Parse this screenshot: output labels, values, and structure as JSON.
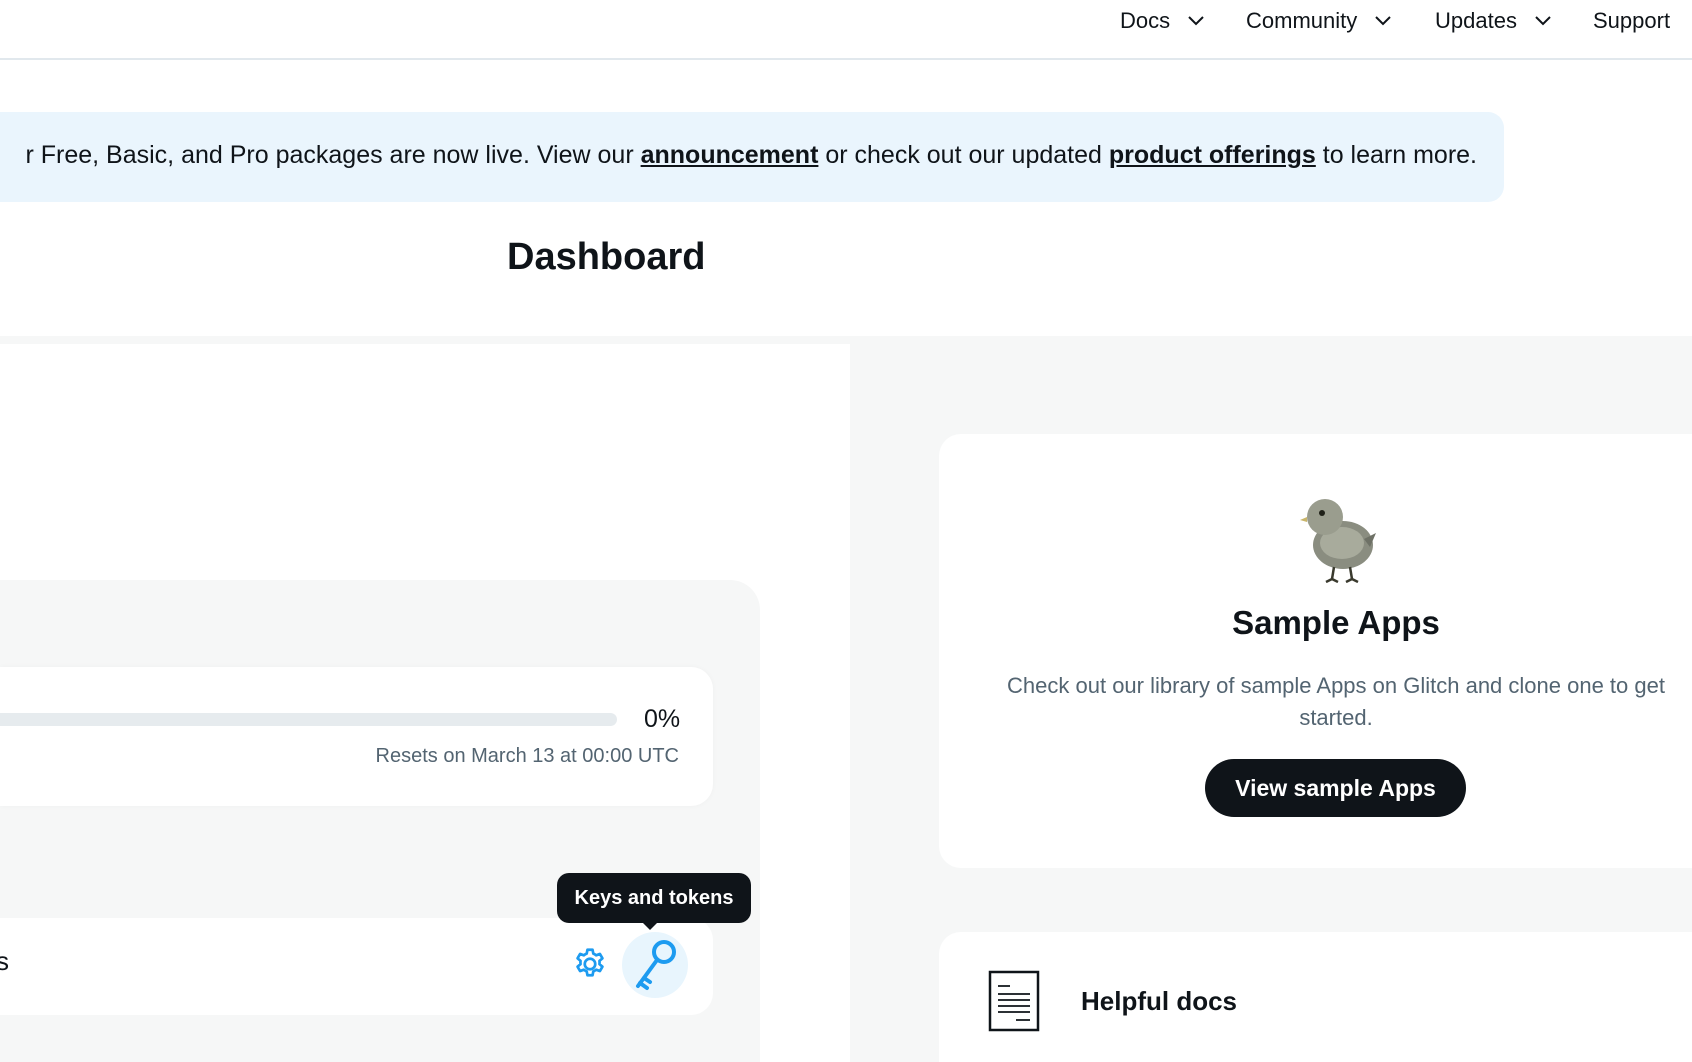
{
  "nav": {
    "items": [
      {
        "label": "Docs",
        "has_dropdown": true
      },
      {
        "label": "Community",
        "has_dropdown": true
      },
      {
        "label": "Updates",
        "has_dropdown": true
      },
      {
        "label": "Support",
        "has_dropdown": false
      }
    ]
  },
  "banner": {
    "text_before": "r Free, Basic, and Pro packages are now live. View our ",
    "link1": "announcement",
    "text_middle": " or check out our updated ",
    "link2": "product offerings",
    "text_after": " to learn more."
  },
  "page": {
    "title": "Dashboard"
  },
  "usage": {
    "percent_label": "0%",
    "progress_fraction": 0,
    "resets_text": "Resets on March 13 at 00:00 UTC"
  },
  "app_row": {
    "stub_text": "s",
    "settings_icon": "gear-icon",
    "keys_icon": "key-icon",
    "tooltip": "Keys and tokens"
  },
  "sample_apps": {
    "title": "Sample Apps",
    "description": "Check out our library of sample Apps on Glitch and clone one to get started.",
    "button_label": "View sample Apps"
  },
  "helpful_docs": {
    "title": "Helpful docs"
  },
  "colors": {
    "accent": "#1d9bf0",
    "text": "#0f1419",
    "muted": "#536471",
    "banner_bg": "#eaf5fd",
    "panel_bg": "#f6f7f7"
  }
}
